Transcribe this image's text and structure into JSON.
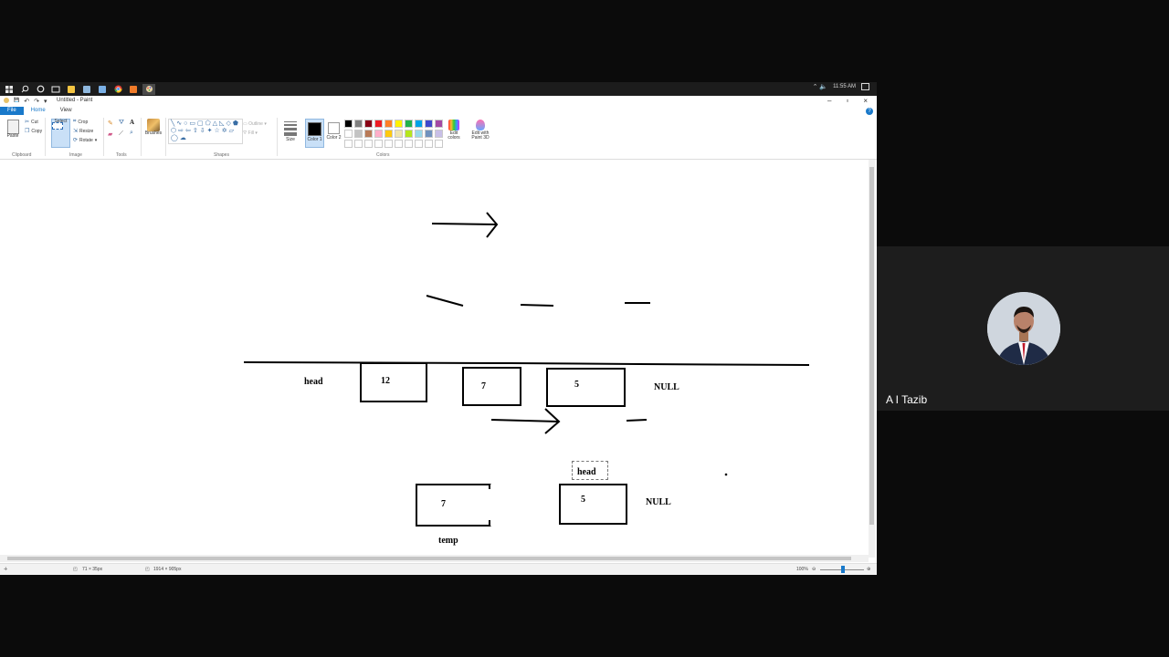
{
  "taskbar": {
    "icons": [
      "windows-start-icon",
      "search-icon",
      "cortana-icon",
      "task-view-icon",
      "file-explorer-icon",
      "notepad-icon",
      "app-icon",
      "chrome-icon",
      "sublime-icon",
      "paint-icon"
    ],
    "tray_glyph": "⌃  🔈",
    "clock": "11:55 AM"
  },
  "window": {
    "title": "Untitled - Paint",
    "quick_access": [
      "💾",
      "↶",
      "↷",
      "▾"
    ]
  },
  "ribbon": {
    "tabs": [
      "File",
      "Home",
      "View"
    ],
    "active_tab": "Home",
    "clipboard": {
      "paste": "Paste",
      "cut": "Cut",
      "copy": "Copy",
      "label": "Clipboard"
    },
    "image": {
      "select": "Select",
      "crop": "Crop",
      "resize": "Resize",
      "rotate": "Rotate",
      "label": "Image"
    },
    "tools": {
      "label": "Tools",
      "text_tool": "A"
    },
    "brushes": {
      "label": "Brushes"
    },
    "shapes": {
      "label": "Shapes",
      "outline": "Outline",
      "fill": "Fill"
    },
    "size": {
      "label": "Size"
    },
    "colors": {
      "color1": "Color 1",
      "color2": "Color 2",
      "edit_colors": "Edit colors",
      "edit_paint3d": "Edit with Paint 3D",
      "label": "Colors",
      "palette": [
        "#000000",
        "#7f7f7f",
        "#880015",
        "#ed1c24",
        "#ff7f27",
        "#fff200",
        "#22b14c",
        "#00a2e8",
        "#3f48cc",
        "#a349a4",
        "#ffffff",
        "#c3c3c3",
        "#b97a57",
        "#ffaec9",
        "#ffc90e",
        "#efe4b0",
        "#b5e61d",
        "#99d9ea",
        "#7092be",
        "#c8bfe7",
        "#ffffff",
        "#ffffff",
        "#ffffff",
        "#ffffff",
        "#ffffff",
        "#ffffff",
        "#ffffff",
        "#ffffff",
        "#ffffff",
        "#ffffff"
      ]
    }
  },
  "canvas": {
    "top_list": {
      "label": "head",
      "nodes": [
        "12",
        "7",
        "5"
      ],
      "end": "NULL"
    },
    "bottom_list": {
      "left_node": "7",
      "left_label": "temp",
      "right_label": "head",
      "right_node": "5",
      "end": "NULL"
    }
  },
  "status": {
    "selection_size": "71 × 35px",
    "image_size": "1914 × 905px",
    "zoom": "100%"
  },
  "participant": {
    "name": "A I Tazib"
  }
}
